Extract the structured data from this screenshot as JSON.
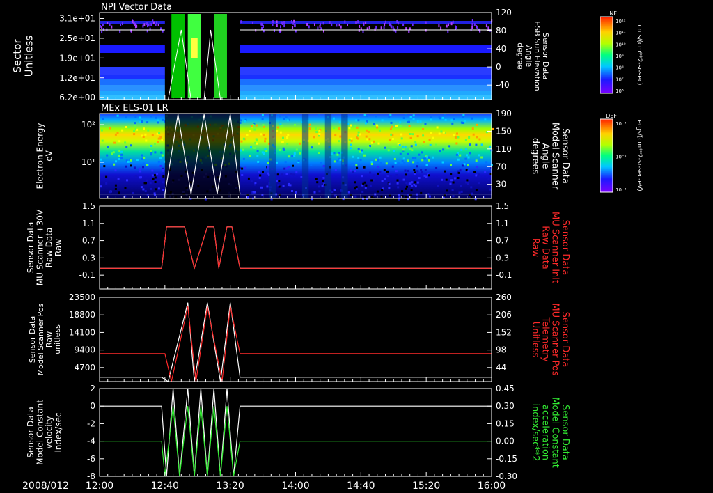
{
  "date_label": "2008/012",
  "colorbars": [
    {
      "label": "NF",
      "unit": "cnts/(cm**2-sr-sec)",
      "ticks": [
        "10¹²",
        "10¹¹",
        "10¹⁰",
        "10⁹",
        "10⁸",
        "10⁷",
        "10⁶"
      ]
    },
    {
      "label": "DEF",
      "unit": "ergs/(cm**2-sr-sec-eV)",
      "ticks": [
        "10⁻⁴",
        "10⁻⁵",
        "10⁻⁶"
      ]
    }
  ],
  "chart_data": [
    {
      "type": "heatmap",
      "title": "NPI Vector Data",
      "ylabel": [
        "Sector",
        "Unitless"
      ],
      "yticks": [
        "3.1e+01",
        "2.5e+01",
        "1.9e+01",
        "1.2e+01",
        "6.2e+00"
      ],
      "y2label": [
        "Sensor Data",
        "ESB Sun Elevation",
        "Angle",
        "degree"
      ],
      "y2ticks": [
        "120",
        "80",
        "40",
        "0",
        "-40"
      ],
      "y2lim": [
        -80,
        120
      ]
    },
    {
      "type": "heatmap",
      "title": "MEx ELS-01 LR",
      "ylabel": [
        "Electron Energy",
        "eV"
      ],
      "yticks": [
        "10²",
        "10¹"
      ],
      "y2label": [
        "Sensor Data",
        "Model Scanner",
        "Angle",
        "degrees"
      ],
      "y2ticks": [
        "190",
        "150",
        "110",
        "70",
        "30"
      ],
      "y2lim": [
        0,
        190
      ]
    },
    {
      "type": "line",
      "ylabel": [
        "Sensor Data",
        "MU Scanner +30V",
        "Raw Data",
        "Raw"
      ],
      "yticks": [
        "1.5",
        "1.1",
        "0.7",
        "0.3",
        "-0.1"
      ],
      "ylim": [
        -0.5,
        1.5
      ],
      "y2label": [
        "Sensor Data",
        "MU Scanner Init",
        "Raw Data",
        "Raw"
      ],
      "y2ticks": [
        "1.5",
        "1.1",
        "0.7",
        "0.3",
        "-0.1"
      ],
      "y2lim": [
        -0.5,
        1.5
      ],
      "series": [
        {
          "color": "#ffffff",
          "x": [
            0,
            38,
            41,
            52,
            58,
            66,
            70,
            73,
            78,
            81,
            86,
            240
          ],
          "y": [
            0,
            0,
            1,
            1,
            0,
            1,
            1,
            0,
            1,
            1,
            0,
            0
          ]
        },
        {
          "color": "#ff2a2a",
          "x": [
            0,
            38,
            41,
            52,
            58,
            66,
            70,
            73,
            78,
            81,
            86,
            240
          ],
          "y": [
            0,
            0,
            1,
            1,
            0,
            1,
            1,
            0,
            1,
            1,
            0,
            0
          ]
        }
      ]
    },
    {
      "type": "line",
      "ylabel": [
        "Sensor Data",
        "Model Scanner Pos",
        "Raw",
        "unitless"
      ],
      "yticks": [
        "23500",
        "18800",
        "14100",
        "9400",
        "4700"
      ],
      "ylim": [
        0,
        23500
      ],
      "y2label": [
        "Sensor Data",
        "MU Scanner Pos",
        "Telemetry",
        "Unitless"
      ],
      "y2ticks": [
        "260",
        "206",
        "152",
        "98",
        "44"
      ],
      "y2lim": [
        -10,
        260
      ],
      "series": [
        {
          "color": "#ffffff",
          "x": [
            0,
            38,
            42,
            54,
            58,
            66,
            74,
            80,
            86,
            240
          ],
          "y": [
            1200,
            1200,
            0,
            22000,
            0,
            22000,
            0,
            22000,
            1200,
            1200
          ]
        },
        {
          "color": "#ff2a2a",
          "x": [
            0,
            40,
            44,
            54,
            59,
            66,
            75,
            80,
            86,
            240
          ],
          "y": [
            7800,
            7800,
            0,
            21000,
            0,
            21000,
            0,
            21000,
            7800,
            7800
          ]
        }
      ]
    },
    {
      "type": "line",
      "ylabel": [
        "Sensor Data",
        "Model Constant",
        "velocity",
        "index/sec"
      ],
      "yticks": [
        "2",
        "0",
        "-2",
        "-4",
        "-6",
        "-8"
      ],
      "ylim": [
        -8,
        2
      ],
      "y2label": [
        "Sensor Data",
        "Model Constant",
        "acceleration",
        "index/sec**2"
      ],
      "y2ticks": [
        "0.45",
        "0.30",
        "0.15",
        "0.00",
        "-0.15",
        "-0.30"
      ],
      "y2lim": [
        -0.3,
        0.45
      ],
      "series": [
        {
          "color": "#ffffff",
          "x": [
            0,
            38,
            41,
            45,
            49,
            54,
            58,
            62,
            66,
            70,
            74,
            78,
            82,
            86,
            240
          ],
          "y": [
            0,
            0,
            -8,
            2,
            -8,
            2,
            -8,
            2,
            -8,
            2,
            -8,
            2,
            -8,
            0,
            0
          ]
        },
        {
          "color": "#33ee33",
          "x": [
            0,
            38,
            40,
            45,
            49,
            54,
            58,
            62,
            66,
            70,
            74,
            78,
            82,
            86,
            240
          ],
          "y": [
            -4,
            -4,
            -8,
            0,
            -8,
            0,
            -8,
            0,
            -8,
            0,
            -8,
            0,
            -8,
            -4,
            -4
          ]
        }
      ]
    }
  ],
  "xaxis": {
    "ticks": [
      "12:00",
      "12:40",
      "13:20",
      "14:00",
      "14:40",
      "15:20",
      "16:00"
    ],
    "xlim": [
      0,
      240
    ]
  }
}
